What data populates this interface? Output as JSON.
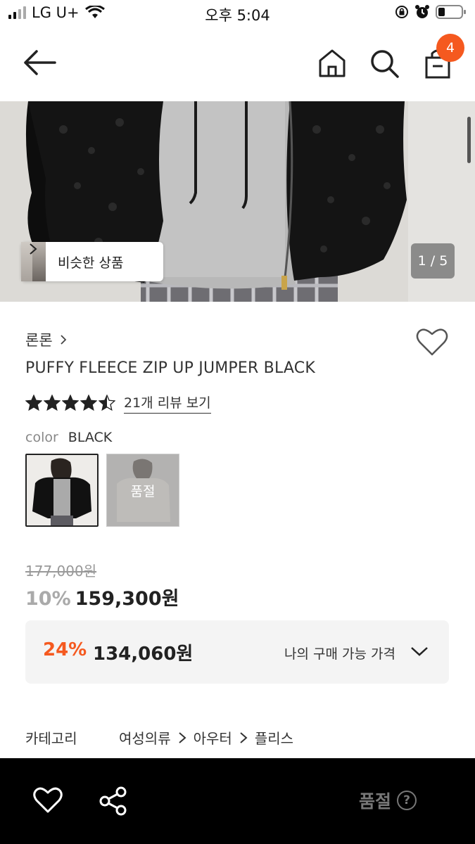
{
  "status_bar": {
    "carrier": "LG U+",
    "time": "오후 5:04"
  },
  "header": {
    "cart_count": "4",
    "icons": [
      "back-arrow-icon",
      "home-icon",
      "search-icon",
      "shopping-bag-icon"
    ]
  },
  "gallery": {
    "similar_label": "비슷한 상품",
    "page_indicator": "1 / 5"
  },
  "product": {
    "brand": "론론",
    "title": "PUFFY FLEECE ZIP UP JUMPER BLACK",
    "rating": 4.5,
    "review_link": "21개 리뷰 보기",
    "color_label": "color",
    "color_value": "BLACK",
    "swatch_soldout": "품절",
    "original_price": "177,000원",
    "discount_rate": "10%",
    "sale_price": "159,300원"
  },
  "my_price": {
    "rate": "24%",
    "price": "134,060원",
    "label": "나의 구매 가능 가격"
  },
  "category": {
    "label": "카테고리",
    "path": [
      "여성의류",
      "아우터",
      "플리스"
    ]
  },
  "bottom_bar": {
    "status": "품절",
    "help": "?"
  },
  "colors": {
    "accent": "#f5591f",
    "bottom_bar_bg": "#000000",
    "price_box_bg": "#f4f4f4"
  }
}
